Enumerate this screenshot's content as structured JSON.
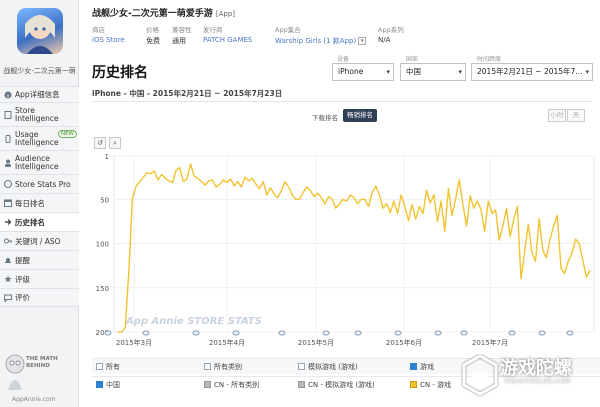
{
  "app": {
    "caption": "战舰少女-二次元第一萌",
    "title": "战舰少女-二次元第一萌爱手游",
    "type_tag": "[App]",
    "meta": [
      {
        "label": "商店",
        "value": "iOS Store"
      },
      {
        "label": "价格",
        "value": "免费"
      },
      {
        "label": "兼容性",
        "value": "通用"
      },
      {
        "label": "发行商",
        "value": "PATCH GAMES"
      },
      {
        "label": "App集合",
        "value": "Warship Girls (1 款App)"
      },
      {
        "label": "App系列",
        "value": "N/A"
      }
    ]
  },
  "sidebar": {
    "items": [
      {
        "label": "App详细信息"
      },
      {
        "label": "Store Intelligence"
      },
      {
        "label": "Usage Intelligence",
        "badge": "NEW"
      },
      {
        "label": "Audience Intelligence"
      },
      {
        "label": "Store Stats Pro"
      },
      {
        "label": "每日排名"
      },
      {
        "label": "历史排名",
        "active": true
      },
      {
        "label": "关键词 / ASO"
      },
      {
        "label": "提醒"
      },
      {
        "label": "评级"
      },
      {
        "label": "评价"
      }
    ],
    "logo_text": "THE MATH BEHIND",
    "logo_url": "AppAnnie.com"
  },
  "page": {
    "title": "历史排名",
    "subheading": "iPhone - 中国 - 2015年2月21日 ~ 2015年7月23日",
    "filters": {
      "device_label": "设备",
      "device": "iPhone",
      "country_label": "国家",
      "country": "中国",
      "date_label": "时间跨度",
      "date_range": "2015年2月21日 ~ 2015年7..."
    },
    "toggle_label": "下载排名",
    "toggle_active": "畅销排名",
    "period_buttons": [
      "小时",
      "天"
    ]
  },
  "chart_data": {
    "type": "line",
    "x_ticks": [
      "2015年3月",
      "2015年4月",
      "2015年5月",
      "2015年6月",
      "2015年7月"
    ],
    "y_ticks": [
      1,
      50,
      100,
      150,
      200
    ],
    "ylim": [
      1,
      200
    ],
    "y_inverted": true,
    "watermark": "App Annie STORE STATS",
    "series": [
      {
        "name": "中国 - 游戏",
        "color": "#f1c232",
        "values": [
          200,
          200,
          195,
          130,
          48,
          35,
          30,
          25,
          20,
          21,
          18,
          28,
          22,
          26,
          29,
          31,
          17,
          14,
          30,
          27,
          10,
          24,
          26,
          30,
          34,
          29,
          28,
          36,
          33,
          28,
          31,
          27,
          35,
          30,
          36,
          25,
          29,
          26,
          33,
          38,
          30,
          45,
          37,
          44,
          48,
          40,
          30,
          36,
          45,
          50,
          50,
          42,
          36,
          40,
          47,
          43,
          48,
          55,
          47,
          50,
          60,
          55,
          50,
          52,
          45,
          48,
          55,
          50,
          50,
          58,
          42,
          35,
          45,
          60,
          55,
          65,
          52,
          66,
          45,
          58,
          74,
          56,
          72,
          58,
          66,
          40,
          54,
          45,
          75,
          52,
          86,
          38,
          68,
          49,
          28,
          56,
          80,
          46,
          60,
          52,
          62,
          86,
          52,
          66,
          62,
          96,
          80,
          60,
          92,
          72,
          58,
          140,
          110,
          78,
          110,
          120,
          72,
          108,
          116,
          95,
          80,
          68,
          128,
          134,
          120,
          112,
          95,
          100,
          118,
          138,
          130
        ]
      }
    ]
  },
  "legend": {
    "row1": [
      "所有",
      "所有类别",
      "模拟游戏 (游戏)",
      "游戏"
    ],
    "row2": [
      "中国",
      "CN - 所有类别",
      "CN - 模拟游戏 (游戏)",
      "CN - 游戏"
    ]
  },
  "watermark": {
    "title": "游戏陀螺",
    "sub": "YOUXITUOLUO.COM"
  },
  "colors": {
    "accent_dark": "#2f3f56",
    "link_blue": "#4a78c2",
    "series_gold": "#f1c232"
  }
}
